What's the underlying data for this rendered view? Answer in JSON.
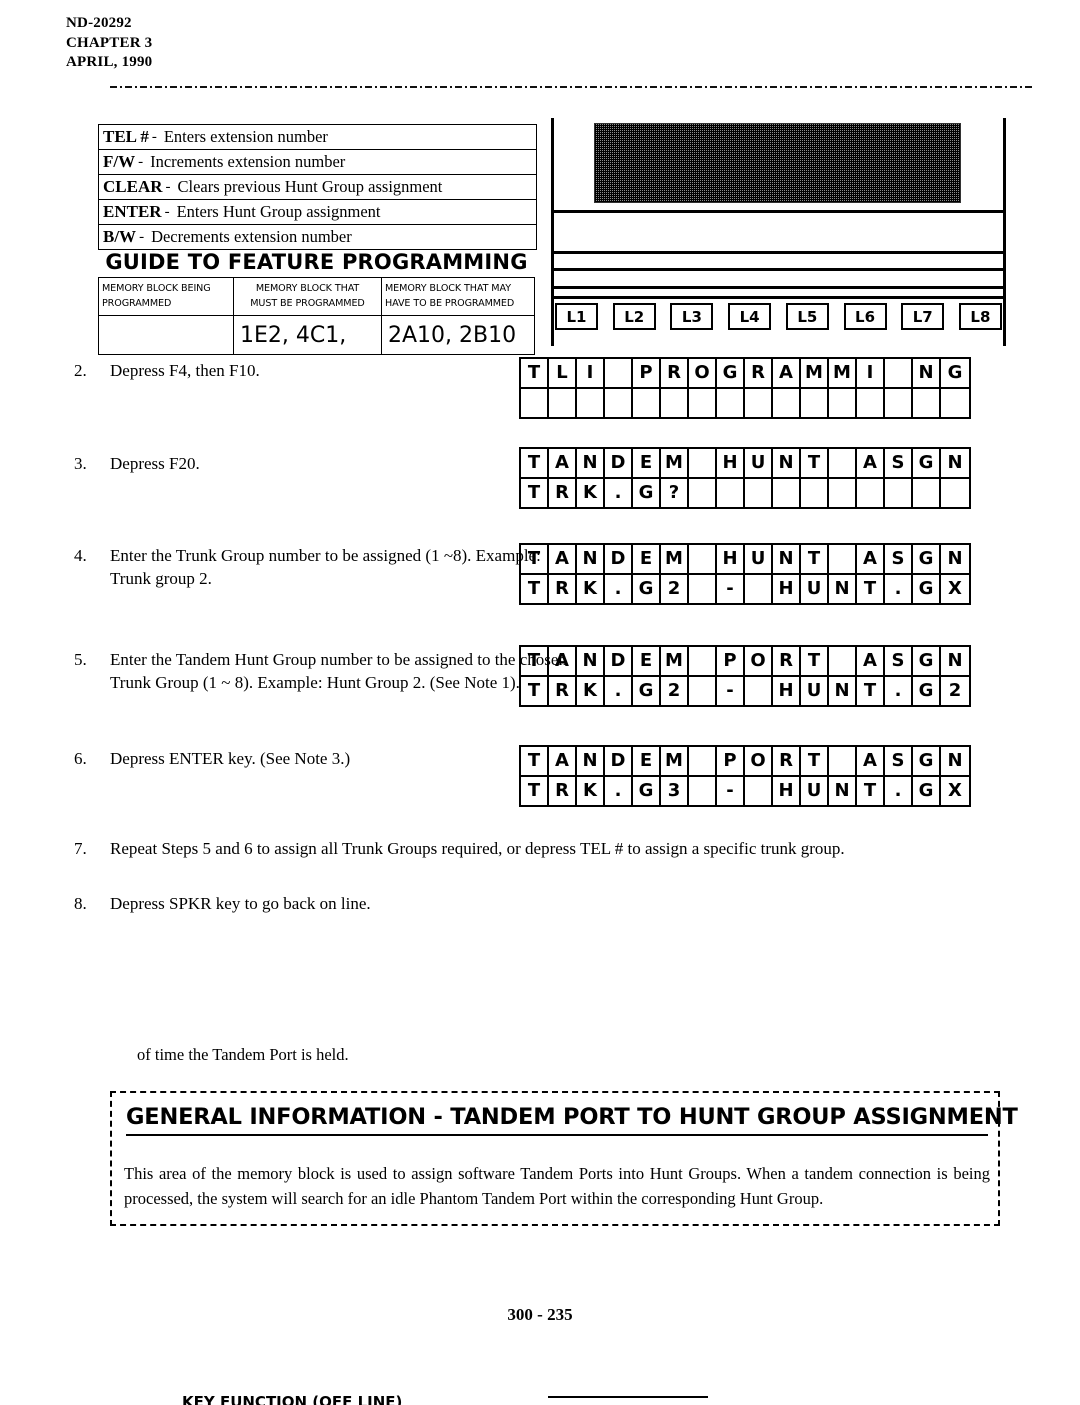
{
  "header": {
    "doc_number": "ND-20292",
    "chapter": "CHAPTER 3",
    "date": "APRIL, 1990"
  },
  "key_legend": [
    {
      "key": "TEL #",
      "dash": "-",
      "desc": "Enters extension number"
    },
    {
      "key": "F/W",
      "dash": "-",
      "desc": "Increments extension number"
    },
    {
      "key": "CLEAR",
      "dash": "-",
      "desc": "Clears previous Hunt Group assignment"
    },
    {
      "key": "ENTER",
      "dash": "-",
      "desc": "Enters Hunt Group assignment"
    },
    {
      "key": "B/W",
      "dash": "-",
      "desc": "Decrements extension number"
    }
  ],
  "guide": {
    "title": "GUIDE TO FEATURE PROGRAMMING",
    "col1_header_line1": "MEMORY BLOCK BEING",
    "col1_header_line2": "PROGRAMMED",
    "col2_header_line1": "MEMORY BLOCK THAT",
    "col2_header_line2": "MUST BE PROGRAMMED",
    "col3_header_line1": "MEMORY BLOCK THAT MAY",
    "col3_header_line2": "HAVE TO BE PROGRAMMED",
    "col1_value": "",
    "col2_value": "1E2, 4C1,",
    "col3_value": "2A10, 2B10"
  },
  "phone_panel": {
    "line_keys": [
      "L1",
      "L2",
      "L3",
      "L4",
      "L5",
      "L6",
      "L7",
      "L8"
    ]
  },
  "steps": [
    {
      "number": "2.",
      "text": "Depress F4,  then F10."
    },
    {
      "number": "3.",
      "text": "Depress  F20."
    },
    {
      "number": "4.",
      "text": "Enter the Trunk Group  number to be assigned (1 ~8).  Example:  Trunk group 2."
    },
    {
      "number": "5.",
      "text": "Enter the Tandem Hunt Group  number  to be assigned to the chosen Trunk Group (1 ~ 8).  Example:  Hunt Group 2.  (See Note  1)."
    },
    {
      "number": "6.",
      "text": "Depress ENTER key. (See Note 3.)"
    },
    {
      "number": "7.",
      "text": "Repeat Steps 5 and 6 to assign all Trunk Groups required, or depress TEL # to assign a specific trunk group."
    },
    {
      "number": "8.",
      "text": "Depress SPKR key to go back on line."
    }
  ],
  "lcd_displays": [
    {
      "id": "lcd-step2",
      "row1": [
        "T",
        "L",
        "I",
        "",
        "P",
        "R",
        "O",
        "G",
        "R",
        "A",
        "M",
        "M",
        "I",
        "",
        "N",
        "G"
      ],
      "row2": [
        "",
        "",
        "",
        "",
        "",
        "",
        "",
        "",
        "",
        "",
        "",
        "",
        "",
        "",
        "",
        ""
      ]
    },
    {
      "id": "lcd-step3",
      "row1": [
        "T",
        "A",
        "N",
        "D",
        "E",
        "M",
        "",
        "H",
        "U",
        "N",
        "T",
        "",
        "A",
        "S",
        "G",
        "N"
      ],
      "row2": [
        "T",
        "R",
        "K",
        ".",
        "G",
        "?",
        "",
        "",
        "",
        "",
        "",
        "",
        "",
        "",
        "",
        ""
      ]
    },
    {
      "id": "lcd-step4",
      "row1": [
        "T",
        "A",
        "N",
        "D",
        "E",
        "M",
        "",
        "H",
        "U",
        "N",
        "T",
        "",
        "A",
        "S",
        "G",
        "N"
      ],
      "row2": [
        "T",
        "R",
        "K",
        ".",
        "G",
        "2",
        "",
        "-",
        "",
        "H",
        "U",
        "N",
        "T",
        ".",
        "G",
        "X"
      ]
    },
    {
      "id": "lcd-step5",
      "row1": [
        "T",
        "A",
        "N",
        "D",
        "E",
        "M",
        "",
        "P",
        "O",
        "R",
        "T",
        "",
        "A",
        "S",
        "G",
        "N"
      ],
      "row2": [
        "T",
        "R",
        "K",
        ".",
        "G",
        "2",
        "",
        "-",
        "",
        "H",
        "U",
        "N",
        "T",
        ".",
        "G",
        "2"
      ]
    },
    {
      "id": "lcd-step6",
      "row1": [
        "T",
        "A",
        "N",
        "D",
        "E",
        "M",
        "",
        "P",
        "O",
        "R",
        "T",
        "",
        "A",
        "S",
        "G",
        "N"
      ],
      "row2": [
        "T",
        "R",
        "K",
        ".",
        "G",
        "3",
        "",
        "-",
        "",
        "H",
        "U",
        "N",
        "T",
        ".",
        "G",
        "X"
      ]
    }
  ],
  "of_time_line": "of time the Tandem Port is held.",
  "general_information": {
    "title": "GENERAL  INFORMATION - TANDEM PORT  TO HUNT  GROUP  ASSIGNMENT",
    "body": "This area of the memory block is used to assign software Tandem Ports into Hunt Groups.  When a tandem connection is being processed, the system will search for an idle Phantom Tandem Port within the corresponding Hunt Group."
  },
  "footer": {
    "page_number": "300 - 235"
  },
  "bottom_cutoff": {
    "text": "KEY FUNCTION (OFF LINE)"
  }
}
